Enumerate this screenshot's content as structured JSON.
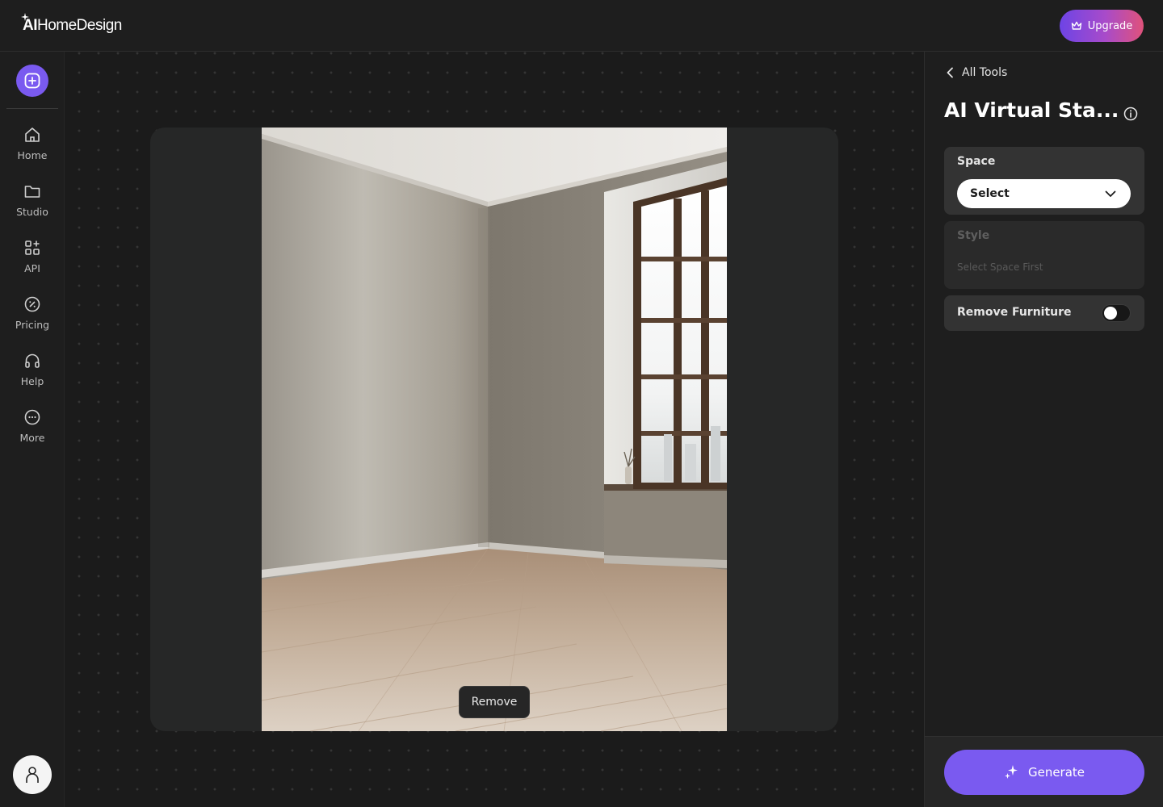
{
  "header": {
    "logo_ai": "AI",
    "logo_rest": "HomeDesign",
    "upgrade_label": "Upgrade"
  },
  "sidebar": {
    "items": [
      {
        "label": "Home",
        "icon": "home-icon"
      },
      {
        "label": "Studio",
        "icon": "folder-icon"
      },
      {
        "label": "API",
        "icon": "grid-plus-icon"
      },
      {
        "label": "Pricing",
        "icon": "percent-badge-icon"
      },
      {
        "label": "Help",
        "icon": "headphones-icon"
      },
      {
        "label": "More",
        "icon": "more-icon"
      }
    ]
  },
  "canvas": {
    "remove_label": "Remove"
  },
  "panel": {
    "back_label": "All Tools",
    "title": "AI Virtual Sta...",
    "space": {
      "label": "Space",
      "value": "Select"
    },
    "style": {
      "label": "Style",
      "hint": "Select Space First"
    },
    "remove_furniture": {
      "label": "Remove Furniture",
      "enabled": false
    },
    "generate_label": "Generate"
  },
  "colors": {
    "accent": "#7a5af0",
    "background": "#1b1b1b",
    "panel": "#1e1e1e"
  }
}
